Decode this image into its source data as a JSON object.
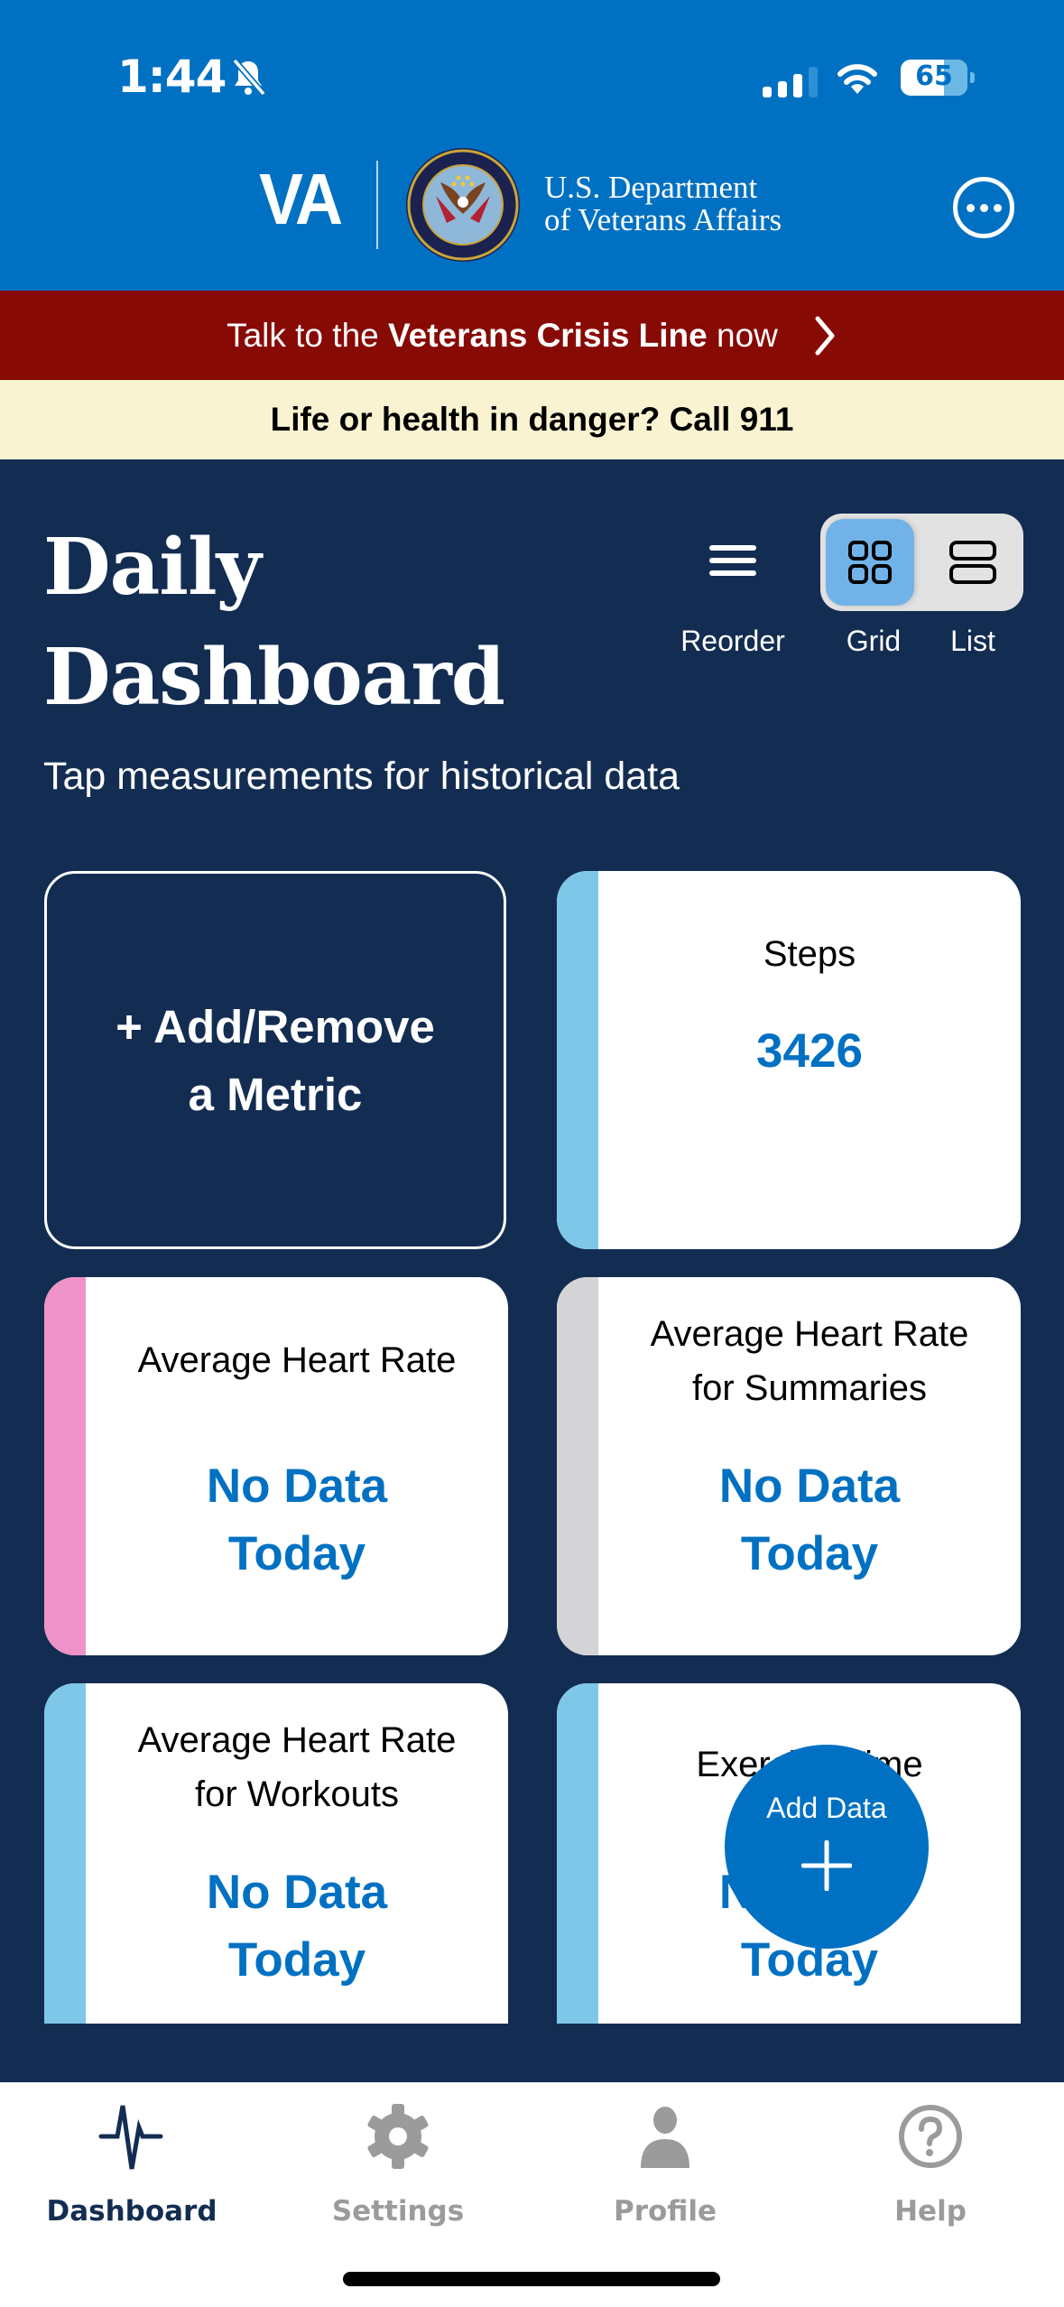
{
  "status_bar": {
    "time": "1:44",
    "silent_icon": "bell-slash-icon",
    "signal_icon": "cellular-signal-icon",
    "wifi_icon": "wifi-icon",
    "battery_level": "65",
    "battery_percent": 65
  },
  "header": {
    "logo_text": "VA",
    "seal_icon": "va-seal-icon",
    "dept_line1": "U.S. Department",
    "dept_line2": "of Veterans Affairs",
    "more_icon": "ellipsis-circle-icon",
    "brand_color": "#0071c2"
  },
  "crisis_banner": {
    "prefix": "Talk to the ",
    "bold": "Veterans Crisis Line",
    "suffix": " now",
    "chevron_icon": "chevron-right-icon",
    "color": "#880a05"
  },
  "danger_banner": {
    "text": "Life or health in danger? Call 911",
    "color": "#faf3d1"
  },
  "dashboard": {
    "title_line1": "Daily",
    "title_line2": "Dashboard",
    "subtitle": "Tap measurements for historical data",
    "reorder_label": "Reorder",
    "grid_label": "Grid",
    "list_label": "List",
    "view_mode": "Grid",
    "background": "#132d52"
  },
  "add_metric": {
    "line1": "+ Add/Remove",
    "line2": "a Metric"
  },
  "cards": [
    {
      "title": "Steps",
      "value": "3426",
      "stripe_color": "#7fc7e8"
    },
    {
      "title": "Average Heart Rate",
      "value_line1": "No Data",
      "value_line2": "Today",
      "stripe_color": "#ee92c8"
    },
    {
      "title_line1": "Average Heart Rate",
      "title_line2": "for Summaries",
      "value_line1": "No Data",
      "value_line2": "Today",
      "stripe_color": "#d4d3d6"
    },
    {
      "title_line1": "Average Heart Rate",
      "title_line2": "for Workouts",
      "value_line1": "No Data",
      "value_line2": "Today",
      "stripe_color": "#7fc7e8"
    },
    {
      "title": "Exercise Time",
      "value_line1": "No Data",
      "value_line2": "Today",
      "stripe_color": "#7fc7e8"
    }
  ],
  "fab": {
    "label": "Add Data",
    "icon": "plus-icon"
  },
  "tabbar": {
    "tabs": [
      {
        "label": "Dashboard",
        "icon": "heartbeat-icon",
        "active": true
      },
      {
        "label": "Settings",
        "icon": "gear-icon",
        "active": false
      },
      {
        "label": "Profile",
        "icon": "person-icon",
        "active": false
      },
      {
        "label": "Help",
        "icon": "question-circle-icon",
        "active": false
      }
    ]
  }
}
